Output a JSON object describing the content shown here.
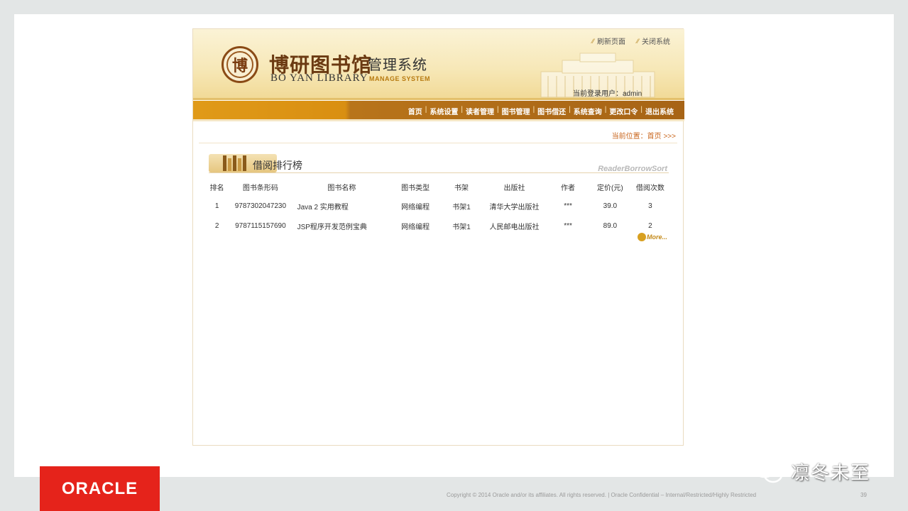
{
  "header": {
    "seal_char": "博",
    "logo_cn": "博研图书馆",
    "logo_cn_suffix": "管理系统",
    "logo_en": "BO YAN LIBRARY",
    "logo_en_suffix": "MANAGE SYSTEM",
    "refresh_link": "刷新页面",
    "close_link": "关闭系统",
    "current_user_label": "当前登录用户：admin"
  },
  "nav": {
    "items": [
      "首页",
      "系统设置",
      "读者管理",
      "图书管理",
      "图书借还",
      "系统查询",
      "更改口令",
      "退出系统"
    ]
  },
  "breadcrumb": "当前位置：首页 >>>",
  "section": {
    "title": "借阅排行榜",
    "title_en": "ReaderBorrowSort"
  },
  "table": {
    "columns": [
      "排名",
      "图书条形码",
      "图书名称",
      "图书类型",
      "书架",
      "出版社",
      "作者",
      "定价(元)",
      "借阅次数"
    ],
    "rows": [
      [
        "1",
        "9787302047230",
        "Java 2 实用教程",
        "网络编程",
        "书架1",
        "清华大学出版社",
        "***",
        "39.0",
        "3"
      ],
      [
        "2",
        "9787115157690",
        "JSP程序开发范例宝典",
        "网络编程",
        "书架1",
        "人民邮电出版社",
        "***",
        "89.0",
        "2"
      ]
    ]
  },
  "more_link": "More...",
  "footer": {
    "brand": "ORACLE",
    "copyright": "Copyright © 2014 Oracle and/or its affiliates. All rights reserved.  |  Oracle Confidential – Internal/Restricted/Highly Restricted",
    "page_number": "39"
  },
  "watermark": "凛冬未至",
  "colors": {
    "nav_orange": "#e09a18",
    "nav_brown": "#a76416",
    "oracle_red": "#e5231b",
    "accent_link": "#c9661d"
  }
}
